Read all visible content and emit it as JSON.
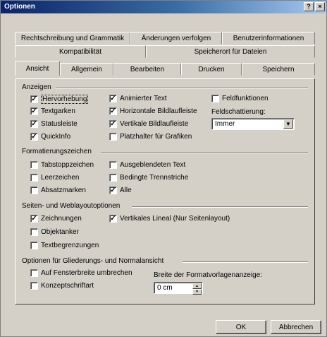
{
  "window": {
    "title": "Optionen",
    "help_label": "?",
    "close_label": "×"
  },
  "tabs": {
    "row1": [
      "Rechtschreibung und Grammatik",
      "Änderungen verfolgen",
      "Benutzerinformationen"
    ],
    "row2": [
      "Kompatibilität",
      "Speicherort für Dateien"
    ],
    "row3": [
      "Ansicht",
      "Allgemein",
      "Bearbeiten",
      "Drucken",
      "Speichern"
    ]
  },
  "anzeigen": {
    "title": "Anzeigen",
    "col1": [
      {
        "label": "Hervorhebung",
        "checked": true
      },
      {
        "label": "Textgarken",
        "checked": true
      },
      {
        "label": "Statusleiste",
        "checked": true
      },
      {
        "label": "QuickInfo",
        "checked": true
      }
    ],
    "col2": [
      {
        "label": "Animierter Text",
        "checked": true
      },
      {
        "label": "Horizontale Bildlaufleiste",
        "checked": true
      },
      {
        "label": "Vertikale Bildlaufleiste",
        "checked": true
      },
      {
        "label": "Platzhalter für Grafiken",
        "checked": false
      }
    ],
    "feldfunktionen": {
      "label": "Feldfunktionen",
      "checked": false
    },
    "feldschattierung_label": "Feldschattierung:",
    "feldschattierung_value": "Immer"
  },
  "formatierung": {
    "title": "Formatierungszeichen",
    "col1": [
      {
        "label": "Tabstoppzeichen",
        "checked": false
      },
      {
        "label": "Leerzeichen",
        "checked": false
      },
      {
        "label": "Absatzmarken",
        "checked": false
      }
    ],
    "col2": [
      {
        "label": "Ausgeblendeten Text",
        "checked": false
      },
      {
        "label": "Bedingte Trennstriche",
        "checked": false
      },
      {
        "label": "Alle",
        "checked": true
      }
    ]
  },
  "seiten": {
    "title": "Seiten- und Weblayoutoptionen",
    "col1": [
      {
        "label": "Zeichnungen",
        "checked": true
      },
      {
        "label": "Objektanker",
        "checked": false
      },
      {
        "label": "Textbegrenzungen",
        "checked": false
      }
    ],
    "col2": [
      {
        "label": "Vertikales Lineal (Nur Seitenlayout)",
        "checked": true
      }
    ]
  },
  "gliederung": {
    "title": "Optionen für Gliederungs- und Normalansicht",
    "items": [
      {
        "label": "Auf Fensterbreite umbrechen",
        "checked": false
      },
      {
        "label": "Konzeptschriftart",
        "checked": false
      }
    ],
    "breite_label": "Breite der Formatvorlagenanzeige:",
    "breite_value": "0 cm"
  },
  "buttons": {
    "ok": "OK",
    "cancel": "Abbrechen"
  }
}
